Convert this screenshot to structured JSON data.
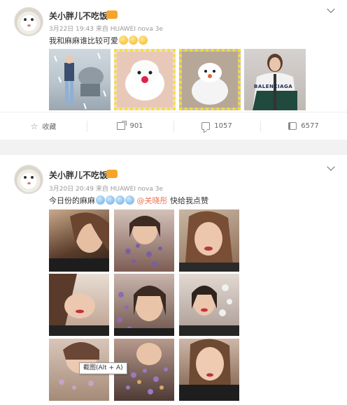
{
  "posts": [
    {
      "user_name": "关小胖儿不吃饭",
      "vip_badge": "VIP",
      "timestamp": "3月22日 19:43",
      "source": "来自 HUAWEI nova 3e",
      "text": "我和麻麻谁比较可爱",
      "actions": {
        "favorite_label": "收藏",
        "repost_count": "901",
        "comment_count": "1057",
        "like_count": "6577"
      },
      "image_sign": "BALENCIAGA"
    },
    {
      "user_name": "关小胖儿不吃饭",
      "vip_badge": "VIP",
      "timestamp": "3月20日 20:49",
      "source": "来自 HUAWEI nova 3e",
      "text_before": "今日份的麻麻",
      "mention": "@关晓彤",
      "text_after": " 快给我点赞"
    }
  ],
  "tooltip": "截图(Alt + A)",
  "colors": {
    "vip": "#f7a42a",
    "mention": "#eb7350",
    "frame": "#f5e02a"
  }
}
